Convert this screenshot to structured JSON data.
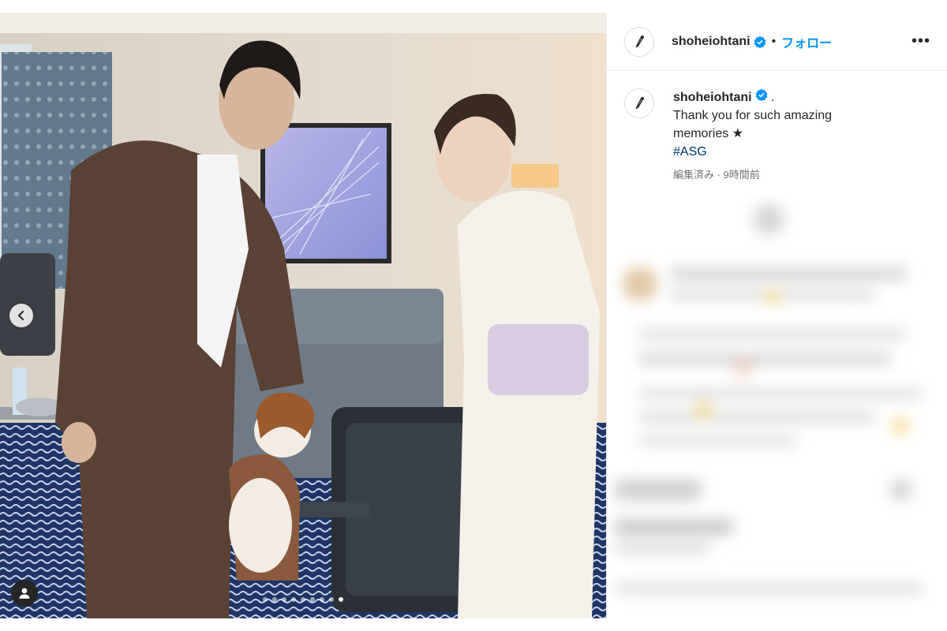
{
  "post": {
    "username": "shoheiohtani",
    "follow_label": "フォロー",
    "separator": "•",
    "more_label": "•••",
    "caption_user": "shoheiohtani",
    "caption_lines": [
      ".",
      "Thank you for such amazing",
      "memories ★",
      "#ASG"
    ],
    "meta": "編集済み · 9時間前"
  },
  "carousel": {
    "slide_count": 9,
    "active_index": 8
  },
  "icons": {
    "verified": "verified-badge-icon",
    "prev": "chevron-left-icon",
    "tag": "user-tag-icon",
    "avatar": "avatar-logo"
  },
  "colors": {
    "accent": "#0095f6",
    "verified": "#0095f6",
    "hashtag": "#00376b",
    "meta": "#737373"
  }
}
